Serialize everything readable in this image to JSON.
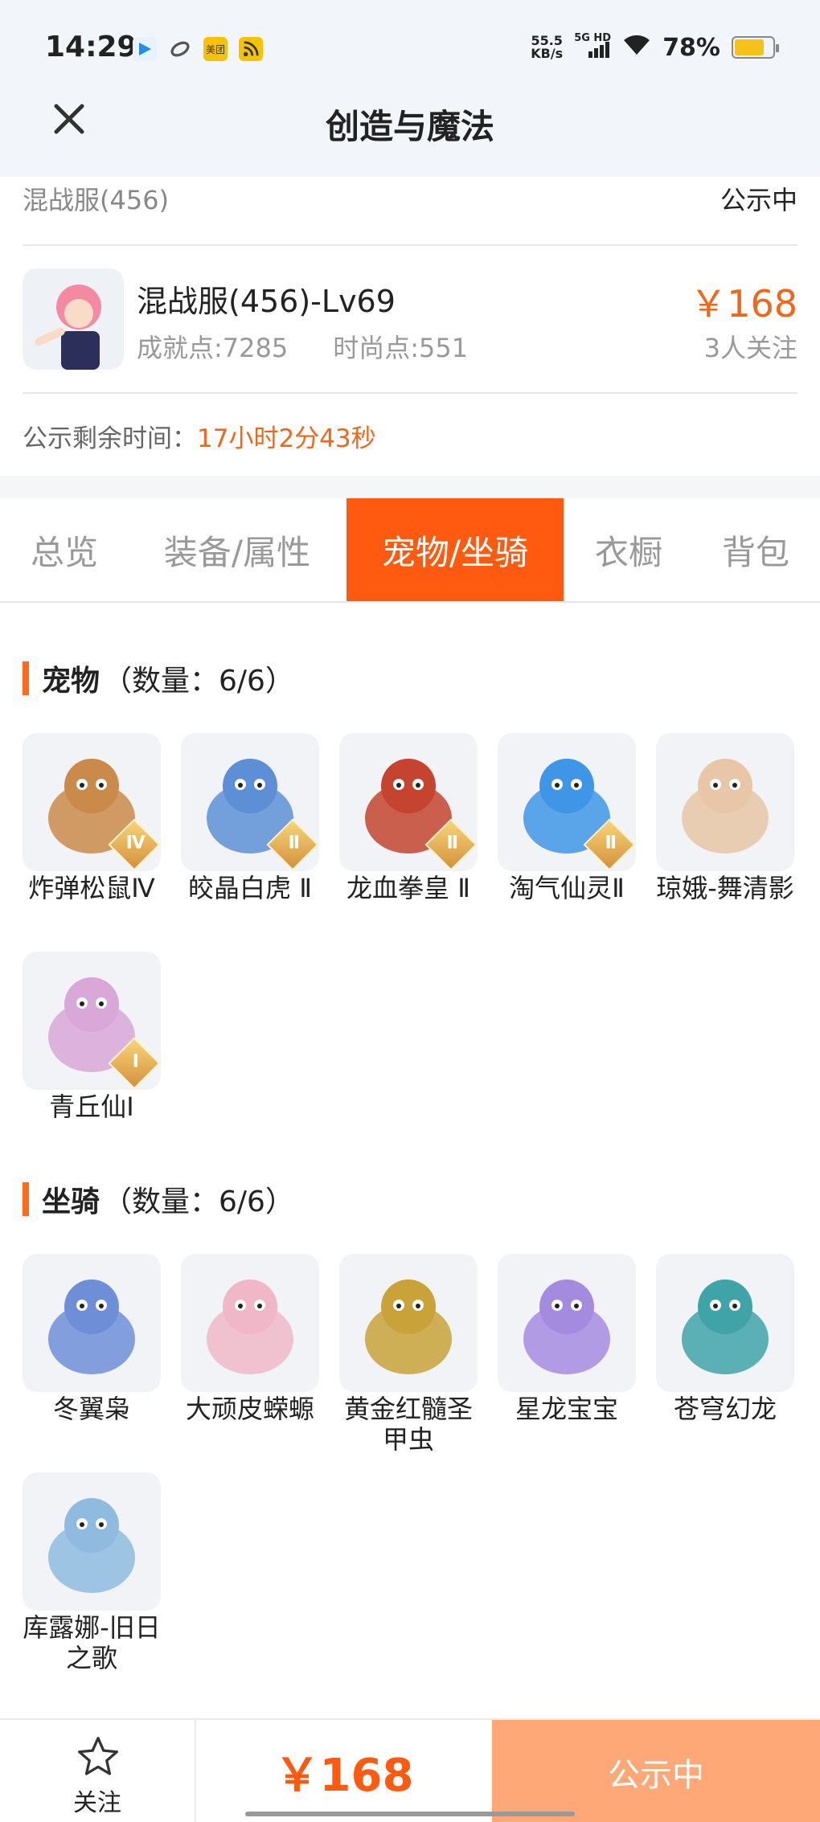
{
  "status_bar": {
    "time": "14:29",
    "app_icons": [
      {
        "icon": "app-play-icon",
        "color": "#1f8ef1",
        "text": ""
      },
      {
        "icon": "app-link-icon",
        "color": "#555555",
        "text": ""
      },
      {
        "icon": "meituan-icon",
        "color": "#f7c200",
        "text": "美团"
      },
      {
        "icon": "rss-icon",
        "color": "#f7c200",
        "text": ""
      }
    ],
    "net_speed": "55.5",
    "net_unit": "KB/s",
    "network": "5G HD",
    "battery": "78%",
    "battery_level": 0.78,
    "battery_color": "#f6c21a"
  },
  "nav": {
    "title": "创造与魔法",
    "close_icon": "close-icon"
  },
  "listing": {
    "server": "混战服(456)",
    "status": "公示中",
    "character_name": "混战服(456)-Lv69",
    "achievement": "成就点:7285",
    "fashion": "时尚点:551",
    "price": "￥168",
    "followers": "3人关注",
    "remain_label": "公示剩余时间：",
    "remain_value": "17小时2分43秒"
  },
  "tabs": [
    {
      "label": "总览",
      "active": false
    },
    {
      "label": "装备/属性",
      "active": false
    },
    {
      "label": "宠物/坐骑",
      "active": true
    },
    {
      "label": "衣橱",
      "active": false
    },
    {
      "label": "背包",
      "active": false
    }
  ],
  "pets_section": {
    "title": "宠物",
    "count": "（数量：6/6）",
    "items": [
      {
        "name": "炸弹松鼠Ⅳ",
        "tier": "Ⅳ",
        "color": "#c98a4a"
      },
      {
        "name": "皎晶白虎 Ⅱ",
        "tier": "Ⅱ",
        "color": "#5d8fd6"
      },
      {
        "name": "龙血拳皇 Ⅱ",
        "tier": "Ⅱ",
        "color": "#c4442f"
      },
      {
        "name": "淘气仙灵Ⅱ",
        "tier": "Ⅱ",
        "color": "#3f95e6"
      },
      {
        "name": "琼娥-舞清影",
        "tier": "",
        "color": "#e8c6a7"
      },
      {
        "name": "青丘仙Ⅰ",
        "tier": "Ⅰ",
        "color": "#d9a7d8"
      }
    ]
  },
  "mounts_section": {
    "title": "坐骑",
    "count": "（数量：6/6）",
    "items": [
      {
        "name": "冬翼枭",
        "color": "#6e8ed8"
      },
      {
        "name": "大顽皮蝾螈",
        "color": "#f0b7c8"
      },
      {
        "name": "黄金红髓圣甲虫",
        "color": "#c9a23a"
      },
      {
        "name": "星龙宝宝",
        "color": "#a58be0"
      },
      {
        "name": "苍穹幻龙",
        "color": "#3fa3a8"
      },
      {
        "name": "库露娜-旧日之歌",
        "color": "#8fbbe0"
      }
    ]
  },
  "bottom": {
    "follow_label": "关注",
    "price": "￥168",
    "status": "公示中"
  },
  "colors": {
    "accent": "#ff5a0f",
    "price": "#f0661a",
    "status_button": "#ffa877"
  }
}
